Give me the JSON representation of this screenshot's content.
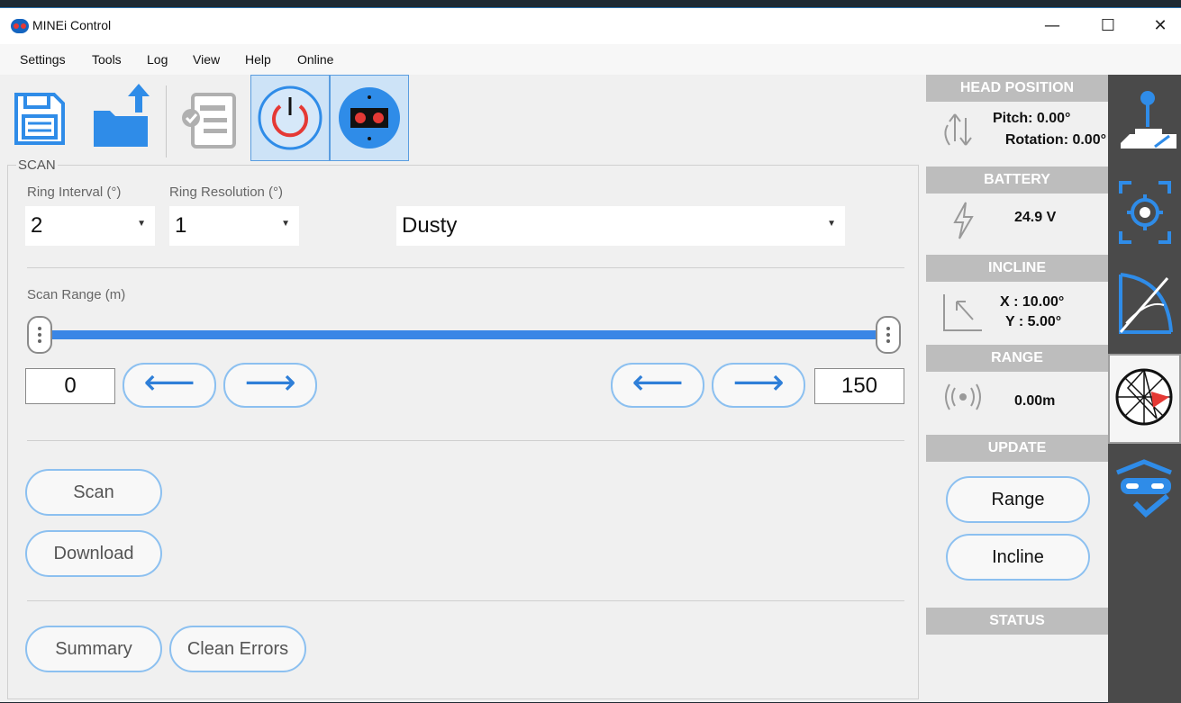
{
  "window": {
    "title": "MINEi Control",
    "minimize": "—",
    "maximize": "☐",
    "close": "✕"
  },
  "menu": [
    "Settings",
    "Tools",
    "Log",
    "View",
    "Help",
    "Online"
  ],
  "scan": {
    "group_label": "SCAN",
    "ring_interval": {
      "label": "Ring Interval (°)",
      "value": "2"
    },
    "ring_resolution": {
      "label": "Ring Resolution (°)",
      "value": "1"
    },
    "environment": {
      "value": "Dusty"
    },
    "range": {
      "label": "Scan Range (m)",
      "min": "0",
      "max": "150",
      "min_value": 0,
      "max_value": 150,
      "slider_min": 0,
      "slider_max": 150
    },
    "buttons": {
      "scan": "Scan",
      "download": "Download",
      "summary": "Summary",
      "clean_errors": "Clean Errors"
    }
  },
  "side": {
    "head_position": {
      "header": "HEAD POSITION",
      "pitch": "Pitch: 0.00°",
      "rotation": "Rotation: 0.00°"
    },
    "battery": {
      "header": "BATTERY",
      "value": "24.9 V"
    },
    "incline": {
      "header": "INCLINE",
      "x": "X : 10.00°",
      "y": "Y : 5.00°"
    },
    "range": {
      "header": "RANGE",
      "value": "0.00m"
    },
    "update": {
      "header": "UPDATE",
      "range_button": "Range",
      "incline_button": "Incline"
    },
    "status": {
      "header": "STATUS"
    }
  },
  "colors": {
    "accent": "#3a86e6",
    "button_border": "#8cc0f0",
    "header_gray": "#bdbdbd",
    "rail": "#4a4a4a",
    "power_red": "#e53935"
  },
  "icons": [
    "save-icon",
    "open-folder-icon",
    "report-icon",
    "power-icon",
    "device-icon",
    "pitch-rotation-icon",
    "lightning-icon",
    "incline-icon",
    "signal-icon",
    "joystick-icon",
    "target-icon",
    "angle-icon",
    "radar-icon",
    "goggles-check-icon"
  ]
}
